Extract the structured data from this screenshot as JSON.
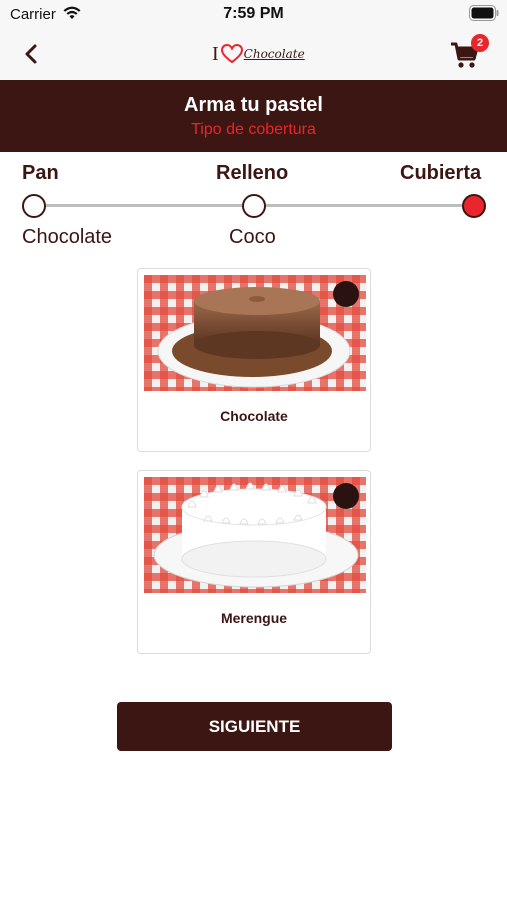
{
  "status_bar": {
    "carrier": "Carrier",
    "time": "7:59 PM"
  },
  "nav": {
    "logo_prefix": "I",
    "logo_word": "Chocolate",
    "cart_count": "2"
  },
  "header": {
    "title": "Arma tu pastel",
    "subtitle": "Tipo de cobertura"
  },
  "stepper": {
    "steps": [
      {
        "label": "Pan",
        "value": "Chocolate",
        "state": "done"
      },
      {
        "label": "Relleno",
        "value": "Coco",
        "state": "done"
      },
      {
        "label": "Cubierta",
        "value": "",
        "state": "active"
      }
    ]
  },
  "options": [
    {
      "label": "Chocolate",
      "image": "chocolate-cake-photo"
    },
    {
      "label": "Merengue",
      "image": "meringue-cake-photo"
    }
  ],
  "next_button": {
    "label": "SIGUIENTE"
  },
  "colors": {
    "brand_dark": "#3b1613",
    "accent_red": "#e8262b"
  }
}
